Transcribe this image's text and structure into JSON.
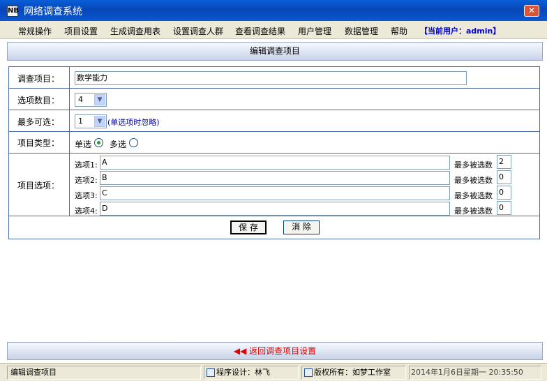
{
  "window": {
    "title": "网络调查系统",
    "app_icon": "NB",
    "close_glyph": "✕"
  },
  "menu": {
    "items": [
      "常规操作",
      "项目设置",
      "生成调查用表",
      "设置调查人群",
      "查看调查结果",
      "用户管理",
      "数据管理",
      "帮助"
    ],
    "user_label": "【当前用户：admin】"
  },
  "panel": {
    "title": "编辑调查项目"
  },
  "form": {
    "item_label": "调查项目：",
    "item_value": "数学能力",
    "option_count_label": "选项数目：",
    "option_count_value": "4",
    "max_select_label": "最多可选：",
    "max_select_value": "1",
    "max_select_hint": "(单选项时忽略)",
    "type_label": "项目类型：",
    "type_single": "单选",
    "type_multi": "多选",
    "type_selected": "single",
    "options_label": "项目选项：",
    "options": [
      {
        "label": "选项1:",
        "value": "A",
        "max_label": "最多被选数",
        "max_value": "2"
      },
      {
        "label": "选项2:",
        "value": "B",
        "max_label": "最多被选数",
        "max_value": "0"
      },
      {
        "label": "选项3:",
        "value": "C",
        "max_label": "最多被选数",
        "max_value": "0"
      },
      {
        "label": "选项4:",
        "value": "D",
        "max_label": "最多被选数",
        "max_value": "0"
      }
    ],
    "save_label": "保  存",
    "clear_label": "消  除"
  },
  "footer": {
    "back_label": "返回调查项目设置",
    "back_icon": "◀◀"
  },
  "status": {
    "page": "编辑调查项目",
    "designer": "程序设计：林飞",
    "copyright": "版权所有：如梦工作室",
    "datetime": "2014年1月6日星期一   20:35:50"
  }
}
